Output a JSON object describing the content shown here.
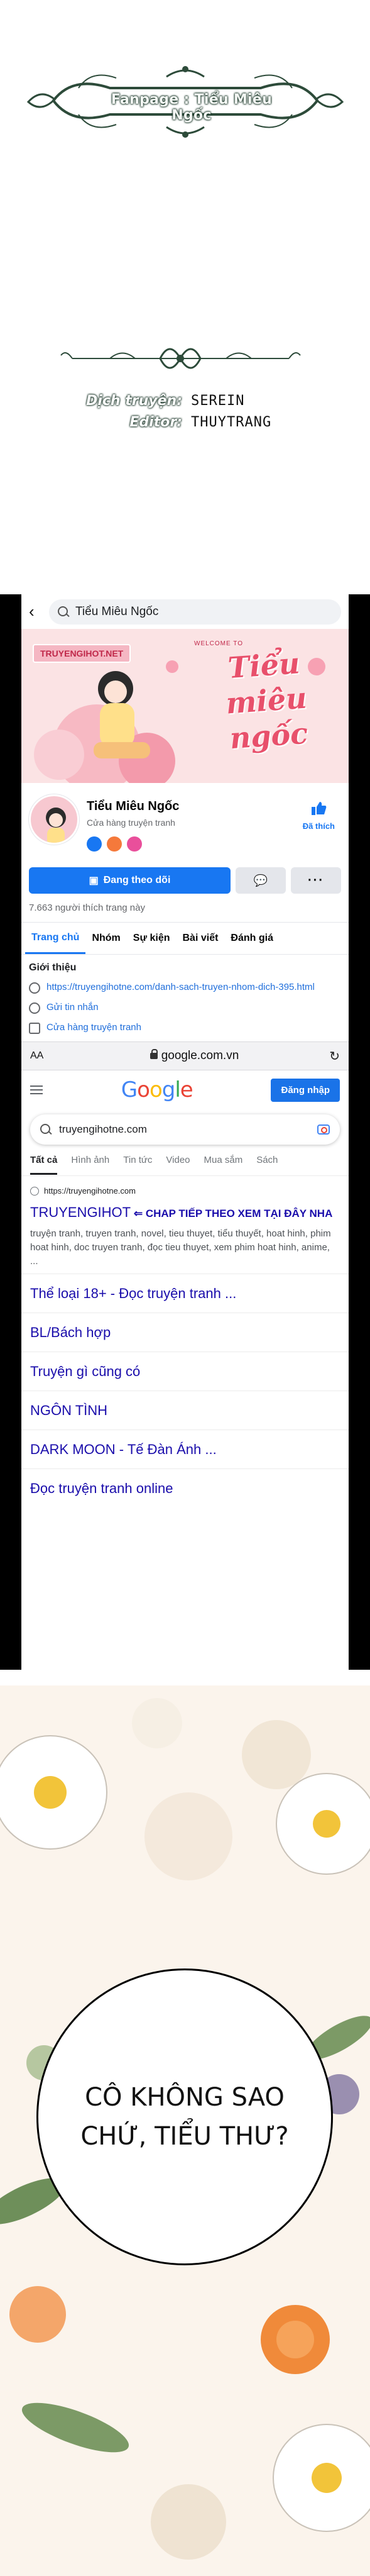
{
  "credits": {
    "fanpage_banner": "Fanpage : Tiểu Miêu Ngốc",
    "translator_label": "Dịch truyện:",
    "translator_value": "SEREIN",
    "editor_label": "Editor:",
    "editor_value": "THUYTRANG"
  },
  "facebook": {
    "search_text": "Tiểu Miêu Ngốc",
    "cover_watermark": "TRUYENGIHOT.NET",
    "cover_small": "WELCOME TO",
    "cover_title_line1": "Tiểu",
    "cover_title_line2": "miêu",
    "cover_title_line3": "ngốc",
    "page_name": "Tiểu Miêu Ngốc",
    "page_category": "Cửa hàng truyện tranh",
    "liked_label": "Đã thích",
    "following_label": "Đang theo dõi",
    "likes_count": "7.663 người thích trang này",
    "tabs": [
      "Trang chủ",
      "Nhóm",
      "Sự kiện",
      "Bài viết",
      "Đánh giá"
    ],
    "intro_title": "Giới thiệu",
    "intro_link": "https://truyengihotne.com/danh-sach-truyen-nhom-dich-395.html",
    "intro_message": "Gửi tin nhắn",
    "intro_category": "Cửa hàng truyện tranh"
  },
  "safari": {
    "aa": "AA",
    "url": "google.com.vn"
  },
  "google": {
    "logo": {
      "G": "G",
      "o1": "o",
      "o2": "o",
      "g": "g",
      "l": "l",
      "e": "e"
    },
    "signin": "Đăng nhập",
    "query": "truyengihotne.com",
    "tabs": [
      "Tất cả",
      "Hình ảnh",
      "Tin tức",
      "Video",
      "Mua sắm",
      "Sách"
    ],
    "result_site": "https://truyengihotne.com",
    "result_title": "TRUYENGIHOT",
    "result_note": " ⇐ CHAP TIẾP THEO XEM TẠI ĐÂY NHA",
    "result_snippet": "truyện tranh, truyen tranh, novel, tieu thuyet, tiểu thuyết, hoat hinh, phim hoat hinh, doc truyen tranh, đọc tieu thuyet, xem phim hoat hinh, anime, ...",
    "sitelinks": [
      "Thể loại 18+ - Đọc truyện tranh ...",
      "BL/Bách hợp",
      "Truyện gì cũng có",
      "NGÔN TÌNH",
      "DARK MOON - Tế Đàn Ánh ...",
      "Đọc truyện tranh online"
    ]
  },
  "panel": {
    "bubble_line1": "CÔ KHÔNG SAO",
    "bubble_line2": "CHỨ, TIỂU THƯ?"
  },
  "colors": {
    "facebook_blue": "#1877f2",
    "google_link": "#1a0dab",
    "banner_green": "#1e3a2c"
  }
}
